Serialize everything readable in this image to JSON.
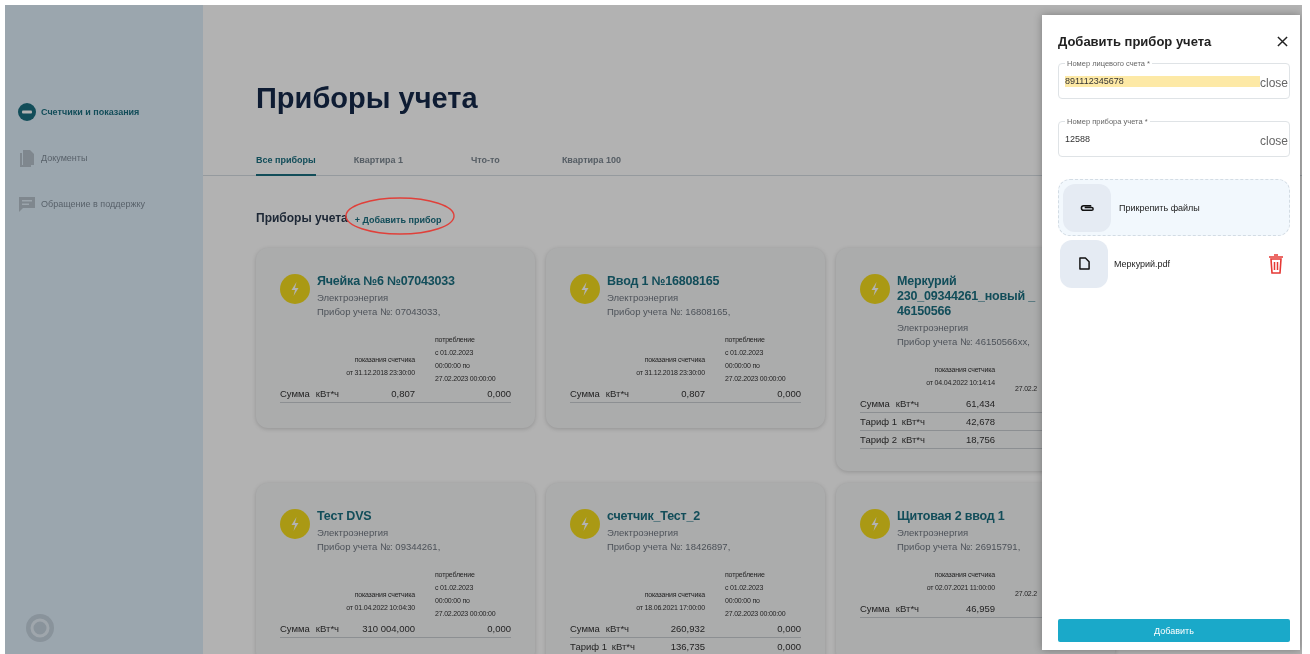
{
  "sidebar": {
    "items": [
      {
        "kind": "meters",
        "label": "Счетчики и показания",
        "selected": true
      },
      {
        "kind": "documents",
        "label": "Документы",
        "selected": false
      },
      {
        "kind": "support",
        "label": "Обращение в поддержку",
        "selected": false
      }
    ]
  },
  "page": {
    "title": "Приборы учета"
  },
  "tabs": [
    {
      "label": "Все приборы",
      "selected": true
    },
    {
      "label": "Квартира 1",
      "selected": false
    },
    {
      "label": "Что-то",
      "selected": false
    },
    {
      "label": "Квартира 100",
      "selected": false
    }
  ],
  "section": {
    "title": "Приборы учета",
    "add_link": "+ Добавить прибор"
  },
  "cards": [
    {
      "title": "Ячейка №6 №07043033",
      "type": "Электроэнергия",
      "serial": "Прибор учета №: 07043033,",
      "reading_header": [
        "показания счетчика",
        "от 31.12.2018 23:30:00"
      ],
      "consumption_header": [
        "потребление",
        "с 01.02.2023",
        "00:00:00 по",
        "27.02.2023 00:00:00"
      ],
      "rows": [
        {
          "label": "Сумма",
          "unit": "кВт*ч",
          "reading": "0,807",
          "consumption": "0,000"
        }
      ]
    },
    {
      "title": "Ввод 1 №16808165",
      "type": "Электроэнергия",
      "serial": "Прибор учета №: 16808165,",
      "reading_header": [
        "показания счетчика",
        "от 31.12.2018 23:30:00"
      ],
      "consumption_header": [
        "потребление",
        "с 01.02.2023",
        "00:00:00 по",
        "27.02.2023 00:00:00"
      ],
      "rows": [
        {
          "label": "Сумма",
          "unit": "кВт*ч",
          "reading": "0,807",
          "consumption": "0,000"
        }
      ]
    },
    {
      "title": "Меркурий 230_09344261_новый _ 46150566",
      "type": "Электроэнергия",
      "serial": "Прибор учета №: 46150566хх,",
      "reading_header": [
        "показания счетчика",
        "от 04.04.2022 10:14:14"
      ],
      "consumption_header": [
        "27.02.2"
      ],
      "rows": [
        {
          "label": "Сумма",
          "unit": "кВт*ч",
          "reading": "61,434"
        },
        {
          "label": "Тариф 1",
          "unit": "кВт*ч",
          "reading": "42,678"
        },
        {
          "label": "Тариф 2",
          "unit": "кВт*ч",
          "reading": "18,756"
        }
      ]
    },
    {
      "title": "Тест DVS",
      "type": "Электроэнергия",
      "serial": "Прибор учета №: 09344261,",
      "reading_header": [
        "показания счетчика",
        "от 01.04.2022 10:04:30"
      ],
      "consumption_header": [
        "потребление",
        "с 01.02.2023",
        "00:00:00 по",
        "27.02.2023 00:00:00"
      ],
      "rows": [
        {
          "label": "Сумма",
          "unit": "кВт*ч",
          "reading": "310 004,000",
          "consumption": "0,000"
        }
      ]
    },
    {
      "title": "счетчик_Тест_2",
      "type": "Электроэнергия",
      "serial": "Прибор учета №: 18426897,",
      "reading_header": [
        "показания счетчика",
        "от 18.06.2021 17:00:00"
      ],
      "consumption_header": [
        "потребление",
        "с 01.02.2023",
        "00:00:00 по",
        "27.02.2023 00:00:00"
      ],
      "rows": [
        {
          "label": "Сумма",
          "unit": "кВт*ч",
          "reading": "260,932",
          "consumption": "0,000"
        },
        {
          "label": "Тариф 1",
          "unit": "кВт*ч",
          "reading": "136,735",
          "consumption": "0,000"
        }
      ]
    },
    {
      "title": "Щитовая 2 ввод 1",
      "type": "Электроэнергия",
      "serial": "Прибор учета №: 26915791,",
      "reading_header": [
        "показания счетчика",
        "от 02.07.2021 11:00:00"
      ],
      "consumption_header": [
        "27.02.2"
      ],
      "rows": [
        {
          "label": "Сумма",
          "unit": "кВт*ч",
          "reading": "46,959"
        }
      ]
    }
  ],
  "drawer": {
    "title": "Добавить прибор учета",
    "fields": [
      {
        "label": "Номер лицевого счета *",
        "value": "891112345678",
        "autofilled": true,
        "clear": "close"
      },
      {
        "label": "Номер прибора учета *",
        "value": "12588",
        "autofilled": false,
        "clear": "close"
      }
    ],
    "attach": {
      "label": "Прикрепить файлы"
    },
    "files": [
      {
        "name": "Меркурий.pdf"
      }
    ],
    "submit": "Добавить"
  }
}
